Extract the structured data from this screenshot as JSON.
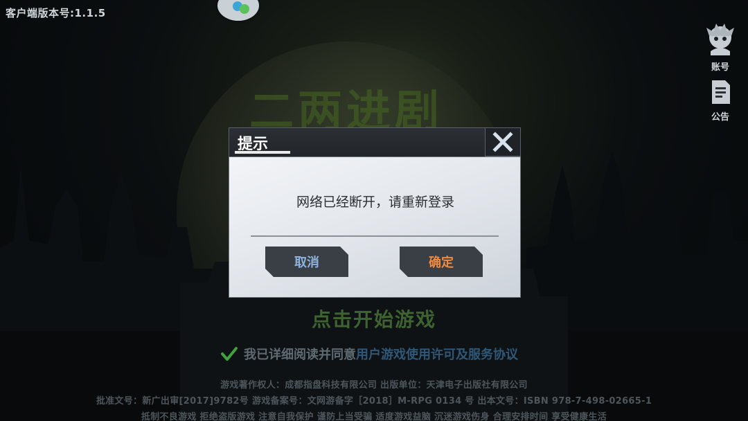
{
  "header": {
    "version_label": "客户端版本号:1.1.5"
  },
  "side": {
    "account_label": "账号",
    "notice_label": "公告"
  },
  "main": {
    "logo_text": "二两进剧",
    "start_text": "点击开始游戏",
    "agreement_prefix": "我已详细阅读并同意",
    "agreement_link": "用户游戏使用许可及服务协议"
  },
  "footer": {
    "line1": "游戏著作权人：成都指盘科技有限公司      出版单位：天津电子出版社有限公司",
    "line2": "批准文号：新广出审[2017]9782号      游戏备案号：文网游备字［2018］M-RPG 0134 号      出本文号：ISBN 978-7-498-02665-1",
    "line3": "抵制不良游戏  拒绝盗版游戏  注意自我保护  谨防上当受骗  适度游戏益脑  沉迷游戏伤身  合理安排时间  享受健康生活"
  },
  "dialog": {
    "title": "提示",
    "message": "网络已经断开，请重新登录",
    "cancel_label": "取消",
    "confirm_label": "确定"
  },
  "colors": {
    "cancel_text": "#8db3e0",
    "confirm_text": "#f08a3e",
    "check_green": "#3fa23a"
  },
  "icons": {
    "close": "close-icon",
    "account": "account-avatar-icon",
    "notice": "notice-document-icon",
    "checkbox": "checkmark-icon"
  }
}
